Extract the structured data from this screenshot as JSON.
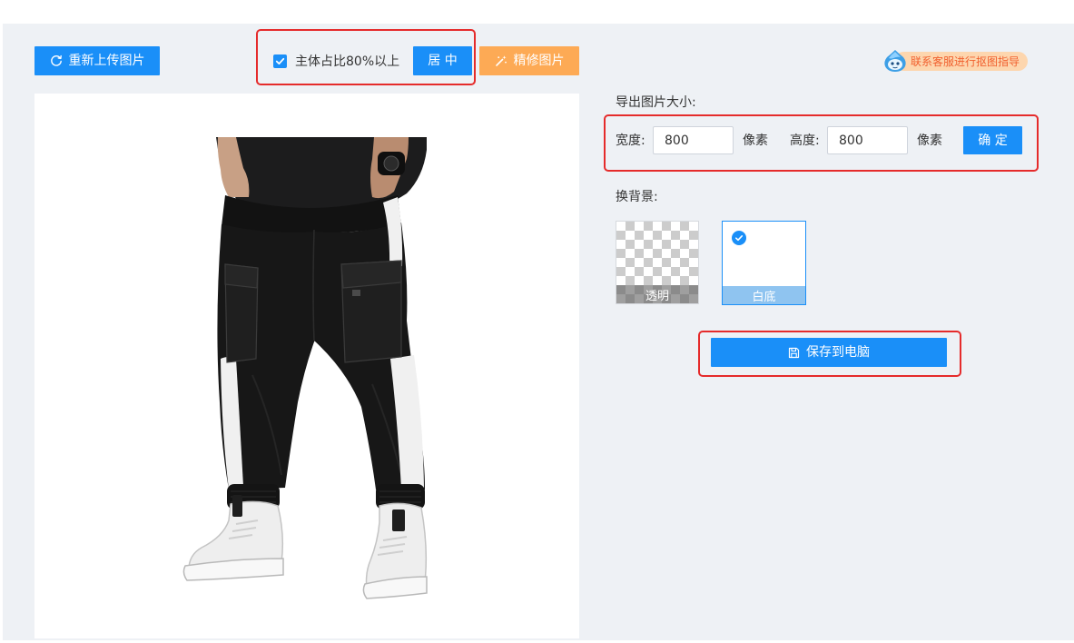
{
  "toolbar": {
    "reupload_label": "重新上传图片",
    "reupload_icon": "refresh-icon",
    "subject_ratio_label": "主体占比80%以上",
    "subject_ratio_checked": true,
    "center_label": "居 中",
    "refine_label": "精修图片",
    "refine_icon": "magic-wand-icon"
  },
  "support": {
    "icon": "mascot-icon",
    "label": "联系客服进行抠图指导"
  },
  "export": {
    "title": "导出图片大小:",
    "width_label": "宽度:",
    "width_value": "800",
    "width_unit": "像素",
    "height_label": "高度:",
    "height_value": "800",
    "height_unit": "像素",
    "confirm_label": "确 定"
  },
  "background": {
    "title": "换背景:",
    "options": [
      {
        "label": "透明",
        "selected": false
      },
      {
        "label": "白底",
        "selected": true
      }
    ]
  },
  "save": {
    "label": "保存到电脑",
    "icon": "save-icon"
  },
  "colors": {
    "primary": "#1a8ff8",
    "accent_orange": "#fdaa55",
    "panel_bg": "#eef1f5",
    "highlight_red": "#e52b2b",
    "support_text": "#f1602e",
    "support_bg": "#fdd6ae"
  }
}
